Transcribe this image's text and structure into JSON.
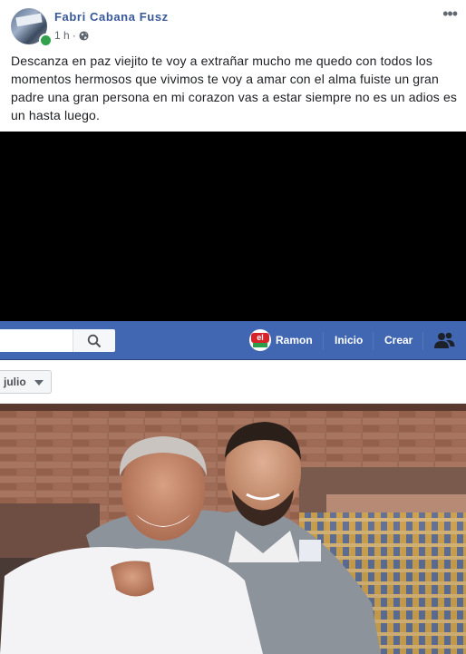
{
  "post": {
    "author": "Fabri Cabana Fusz",
    "time": "1 h",
    "separator": "·",
    "privacy_icon": "globe-icon",
    "more_icon": "more-options-icon",
    "text": "Descanza en paz viejito te voy a extrañar mucho me quedo con todos los momentos hermosos que vivimos te voy a amar con el alma fuiste un gran padre una gran persona en mi corazon vas a estar siempre no es un adios es un hasta luego."
  },
  "fb_bar": {
    "profile_logo_text": "el",
    "profile_name": "Ramon",
    "home_label": "Inicio",
    "create_label": "Crear",
    "search_icon": "search-icon",
    "friends_icon": "friend-requests-icon"
  },
  "filter": {
    "selected": "julio"
  },
  "colors": {
    "fb_blue": "#4267b2",
    "author_link": "#385898",
    "online": "#31a24c"
  }
}
